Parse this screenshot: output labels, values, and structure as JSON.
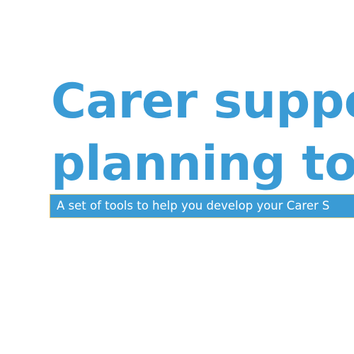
{
  "title": {
    "line1": "Carer support",
    "line2": "planning tool"
  },
  "subtitle": "A set of tools to help you develop your Carer S",
  "colors": {
    "title": "#3a9bd5",
    "subtitle_bar_bg": "#3a9bd5",
    "subtitle_bar_border": "#d9c27a",
    "subtitle_text": "#ffffff",
    "background": "#ffffff"
  }
}
